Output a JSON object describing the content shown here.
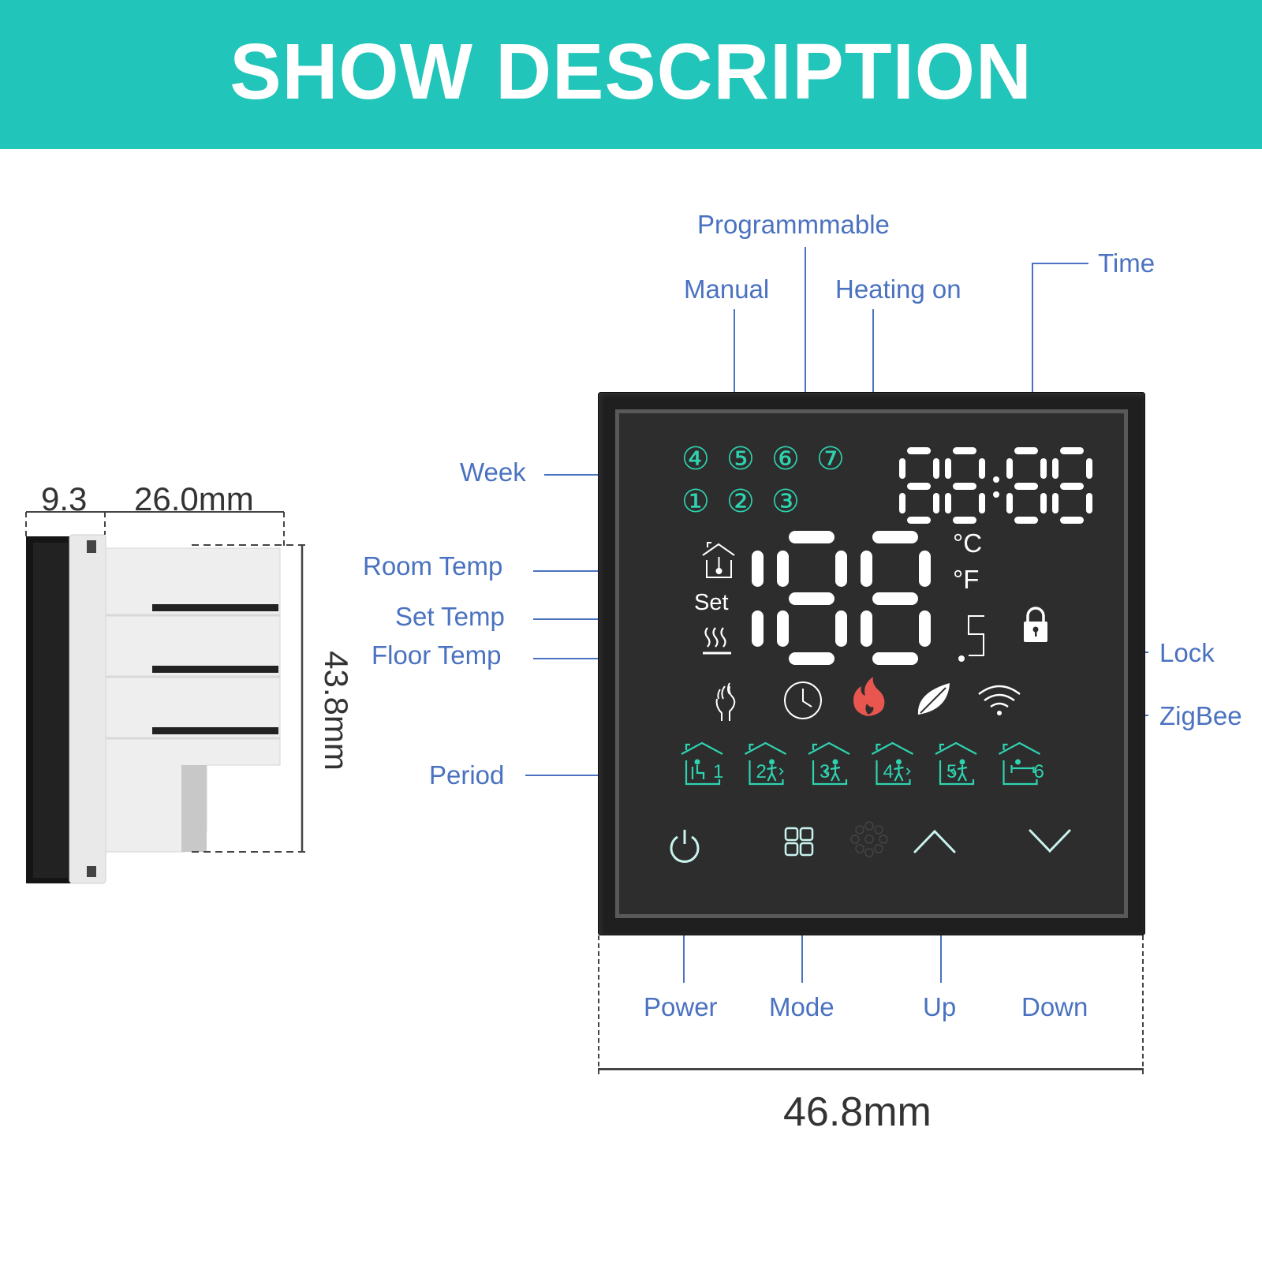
{
  "banner": {
    "title": "SHOW DESCRIPTION",
    "color": "#22c5b9"
  },
  "callouts": {
    "top": {
      "programmable": "Programmmable",
      "manual": "Manual",
      "heating_on": "Heating on",
      "time": "Time"
    },
    "left": {
      "week": "Week",
      "room_temp": "Room Temp",
      "set_temp": "Set Temp",
      "floor_temp": "Floor Temp",
      "period": "Period"
    },
    "right": {
      "lock": "Lock",
      "zigbee": "ZigBee"
    },
    "bottom": {
      "power": "Power",
      "mode": "Mode",
      "up": "Up",
      "down": "Down"
    },
    "color": "#4a72c0"
  },
  "dimensions": {
    "front_depth": "9.3",
    "body_depth": "26.0mm",
    "height": "43.8mm",
    "width": "46.8mm"
  },
  "display": {
    "week_days_top": [
      "④",
      "⑤",
      "⑥",
      "⑦"
    ],
    "week_days_bottom": [
      "①",
      "②",
      "③"
    ],
    "clock": "88:88",
    "set_label": "Set",
    "unit_c": "°C",
    "unit_f": "°F",
    "decimal": ".5",
    "periods": [
      "1",
      "2",
      "3",
      "4",
      "5",
      "6"
    ],
    "accent_color": "#2ed3b0",
    "flame_color": "#e8564f"
  }
}
